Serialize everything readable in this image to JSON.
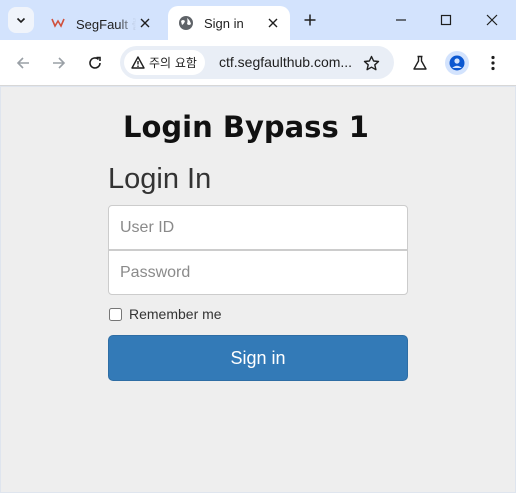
{
  "browser": {
    "tabs": [
      {
        "title": "SegFault 플",
        "active": false
      },
      {
        "title": "Sign in",
        "active": true
      }
    ],
    "security_label": "주의 요함",
    "url": "ctf.segfaulthub.com..."
  },
  "page": {
    "title": "Login Bypass 1",
    "form_heading": "Login In",
    "user_placeholder": "User ID",
    "password_placeholder": "Password",
    "remember_label": "Remember me",
    "submit_label": "Sign in"
  },
  "colors": {
    "tabstrip": "#d3e3fd",
    "accent_button": "#337ab7",
    "page_background": "#eeeeee"
  }
}
